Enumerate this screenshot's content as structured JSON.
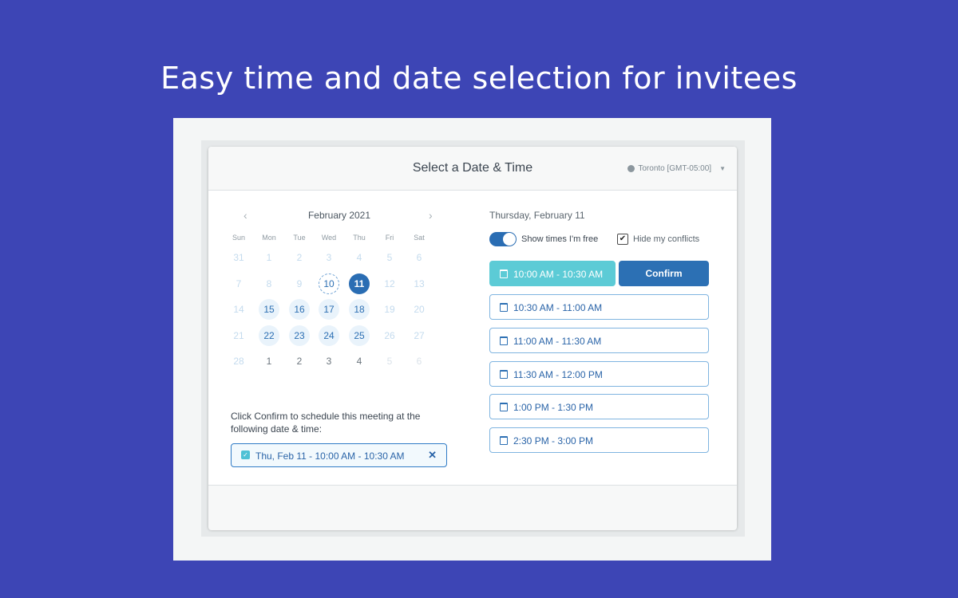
{
  "headline": "Easy time and date selection for invitees",
  "header": {
    "title": "Select a Date & Time",
    "timezone": "Toronto [GMT-05:00]"
  },
  "calendar": {
    "month_label": "February 2021",
    "prev_icon": "chevron-left-icon",
    "next_icon": "chevron-right-icon",
    "weekdays": [
      "Sun",
      "Mon",
      "Tue",
      "Wed",
      "Thu",
      "Fri",
      "Sat"
    ],
    "weeks": [
      [
        {
          "d": "31",
          "s": "past"
        },
        {
          "d": "1",
          "s": "past"
        },
        {
          "d": "2",
          "s": "past"
        },
        {
          "d": "3",
          "s": "past"
        },
        {
          "d": "4",
          "s": "past"
        },
        {
          "d": "5",
          "s": "past"
        },
        {
          "d": "6",
          "s": "past"
        }
      ],
      [
        {
          "d": "7",
          "s": "past"
        },
        {
          "d": "8",
          "s": "past"
        },
        {
          "d": "9",
          "s": "past"
        },
        {
          "d": "10",
          "s": "today"
        },
        {
          "d": "11",
          "s": "selected"
        },
        {
          "d": "12",
          "s": "past"
        },
        {
          "d": "13",
          "s": "past"
        }
      ],
      [
        {
          "d": "14",
          "s": "past"
        },
        {
          "d": "15",
          "s": "avail"
        },
        {
          "d": "16",
          "s": "avail"
        },
        {
          "d": "17",
          "s": "avail"
        },
        {
          "d": "18",
          "s": "avail"
        },
        {
          "d": "19",
          "s": "past"
        },
        {
          "d": "20",
          "s": "past"
        }
      ],
      [
        {
          "d": "21",
          "s": "past"
        },
        {
          "d": "22",
          "s": "avail"
        },
        {
          "d": "23",
          "s": "avail"
        },
        {
          "d": "24",
          "s": "avail"
        },
        {
          "d": "25",
          "s": "avail"
        },
        {
          "d": "26",
          "s": "past"
        },
        {
          "d": "27",
          "s": "past"
        }
      ],
      [
        {
          "d": "28",
          "s": "past"
        },
        {
          "d": "1",
          "s": "next"
        },
        {
          "d": "2",
          "s": "next"
        },
        {
          "d": "3",
          "s": "next"
        },
        {
          "d": "4",
          "s": "next"
        },
        {
          "d": "5",
          "s": "next-faded"
        },
        {
          "d": "6",
          "s": "next-faded"
        }
      ]
    ]
  },
  "confirm_instructions": "Click Confirm to schedule this meeting at the following date & time:",
  "selection": {
    "label": "Thu, Feb 11 - 10:00 AM - 10:30 AM",
    "remove": "✕"
  },
  "day_panel": {
    "date_label": "Thursday, February 11",
    "toggle_label": "Show times I'm free",
    "toggle_on": true,
    "checkbox_label": "Hide my conflicts",
    "checkbox_checked": true,
    "confirm_label": "Confirm",
    "slots": [
      {
        "label": "10:00 AM - 10:30 AM",
        "selected": true
      },
      {
        "label": "10:30 AM - 11:00 AM",
        "selected": false
      },
      {
        "label": "11:00 AM - 11:30 AM",
        "selected": false
      },
      {
        "label": "11:30 AM - 12:00 PM",
        "selected": false
      },
      {
        "label": "1:00 PM - 1:30 PM",
        "selected": false
      },
      {
        "label": "2:30 PM - 3:00 PM",
        "selected": false
      }
    ]
  },
  "colors": {
    "background": "#3d45b5",
    "primary": "#2c70b4",
    "selected_slot": "#5ccbd6"
  }
}
